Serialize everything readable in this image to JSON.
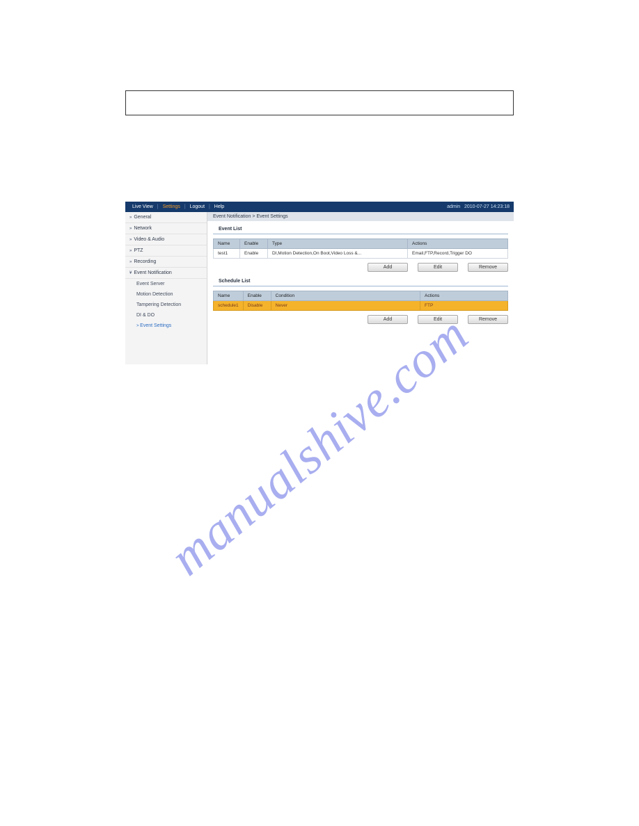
{
  "watermark": "manualshive.com",
  "topbar": {
    "links": [
      "Live View",
      "Settings",
      "Logout",
      "Help"
    ],
    "user": "admin",
    "datetime": "2010-07-27  14:23:18"
  },
  "sidebar": {
    "items": [
      {
        "label": "General"
      },
      {
        "label": "Network"
      },
      {
        "label": "Video & Audio"
      },
      {
        "label": "PTZ"
      },
      {
        "label": "Recording"
      },
      {
        "label": "Event Notification",
        "subs": [
          {
            "label": "Event Server"
          },
          {
            "label": "Motion Detection"
          },
          {
            "label": "Tampering Detection"
          },
          {
            "label": "DI & DO"
          },
          {
            "label": "Event Settings",
            "active": true
          }
        ]
      }
    ]
  },
  "breadcrumb": "Event Notification > Event Settings",
  "eventlist": {
    "title": "Event List",
    "headers": [
      "Name",
      "Enable",
      "Type",
      "Actions"
    ],
    "rows": [
      {
        "name": "test1",
        "enable": "Enable",
        "type": "DI,Motion Detection,On Boot,Video Loss &...",
        "actions": "Email,FTP,Record,Trigger DO"
      }
    ],
    "buttons": {
      "add": "Add",
      "edit": "Edit",
      "remove": "Remove"
    }
  },
  "schedulelist": {
    "title": "Schedule List",
    "headers": [
      "Name",
      "Enable",
      "Condition",
      "Actions"
    ],
    "rows": [
      {
        "name": "schedule1",
        "enable": "Disable",
        "condition": "Never",
        "actions": "FTP"
      }
    ],
    "buttons": {
      "add": "Add",
      "edit": "Edit",
      "remove": "Remove"
    }
  }
}
